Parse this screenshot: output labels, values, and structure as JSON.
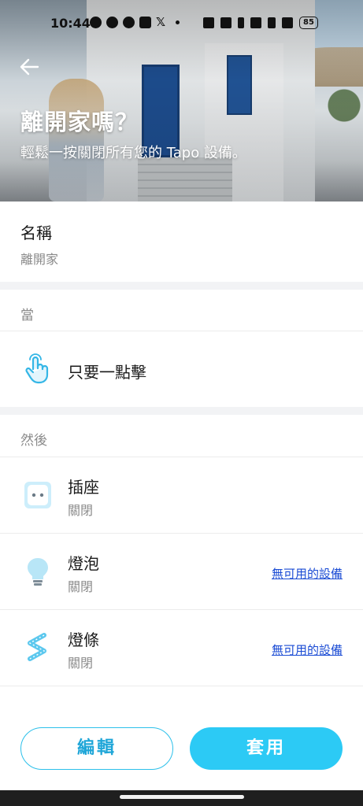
{
  "status_bar": {
    "time": "10:44",
    "battery": "85"
  },
  "hero": {
    "back_icon": "arrow-left-icon",
    "title": "離開家嗎？",
    "subtitle": "輕鬆一按關閉所有您的 Tapo 設備。"
  },
  "name_section": {
    "label": "名稱",
    "value": "離開家"
  },
  "when_section": {
    "header": "當",
    "trigger": {
      "icon": "tap-hand-icon",
      "label": "只要一點擊"
    }
  },
  "then_section": {
    "header": "然後",
    "actions": [
      {
        "icon": "plug-icon",
        "title": "插座",
        "status": "關閉",
        "link": ""
      },
      {
        "icon": "bulb-icon",
        "title": "燈泡",
        "status": "關閉",
        "link": "無可用的設備"
      },
      {
        "icon": "lightstrip-icon",
        "title": "燈條",
        "status": "關閉",
        "link": "無可用的設備"
      }
    ]
  },
  "buttons": {
    "edit": "編輯",
    "apply": "套用"
  },
  "colors": {
    "accent": "#2ccaf5",
    "link": "#1a4bd4",
    "muted": "#8a8a8a"
  }
}
